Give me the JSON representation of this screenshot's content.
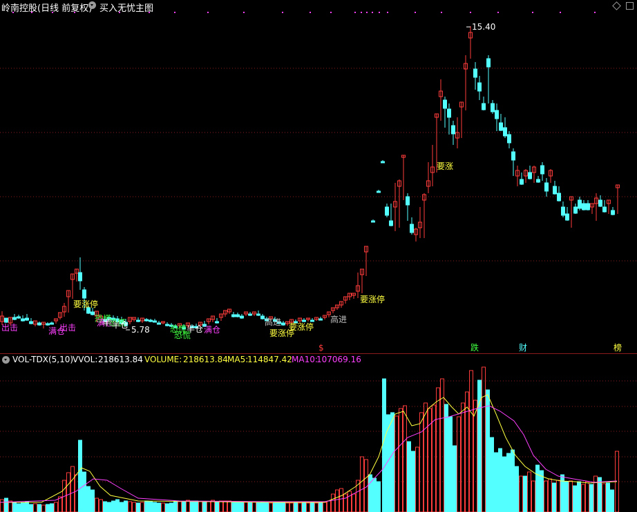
{
  "header": {
    "stock_title": "岭南控股(日线 前复权)",
    "indicator_name": "买入无忧主图"
  },
  "volume_header": {
    "indicator": "VOL-TDX(5,10)",
    "vvol_label": "VVOL:",
    "vvol_value": "218613.84",
    "volume_label": "VOLUME:",
    "volume_value": "218613.84",
    "ma5_label": "MA5:",
    "ma5_value": "114847.42",
    "ma10_label": "MA10:",
    "ma10_value": "107069.16"
  },
  "colors": {
    "up": "#ff3c3c",
    "down": "#54ffff",
    "grid": "#8c1c1c",
    "ma5": "#ffff40",
    "ma10": "#ff40ff",
    "label_yellow": "#ffff40",
    "label_magenta": "#ff40ff",
    "label_green": "#40ff40",
    "label_white": "#ffffff",
    "label_gray": "#c0c0c0"
  },
  "price_labels": [
    {
      "text": "15.40",
      "color": "label_white"
    },
    {
      "text": "5.78",
      "color": "label_white"
    }
  ],
  "signals": [
    {
      "text": "出击",
      "color": "label_magenta"
    },
    {
      "text": "满仓",
      "color": "label_magenta"
    },
    {
      "text": "出击",
      "color": "label_magenta"
    },
    {
      "text": "要涨停",
      "color": "label_yellow"
    },
    {
      "text": "恐慌",
      "color": "label_green"
    },
    {
      "text": "满仓",
      "color": "label_magenta"
    },
    {
      "text": "半",
      "color": "label_white"
    },
    {
      "text": "恐慌",
      "color": "label_green"
    },
    {
      "text": "半仓",
      "color": "label_white"
    },
    {
      "text": "恐慌",
      "color": "label_green"
    },
    {
      "text": "恐慌",
      "color": "label_green"
    },
    {
      "text": "半仓",
      "color": "label_white"
    },
    {
      "text": "满仓",
      "color": "label_magenta"
    },
    {
      "text": "高进",
      "color": "label_gray"
    },
    {
      "text": "要涨停",
      "color": "label_yellow"
    },
    {
      "text": "要涨停",
      "color": "label_yellow"
    },
    {
      "text": "高进",
      "color": "label_gray"
    },
    {
      "text": "要涨停",
      "color": "label_yellow"
    },
    {
      "text": "要涨",
      "color": "label_yellow"
    }
  ],
  "event_tags": [
    {
      "text": "$",
      "color": "up"
    },
    {
      "text": "跌",
      "color": "label_green"
    },
    {
      "text": "财",
      "color": "down"
    },
    {
      "text": "榜",
      "color": "label_yellow"
    }
  ]
}
